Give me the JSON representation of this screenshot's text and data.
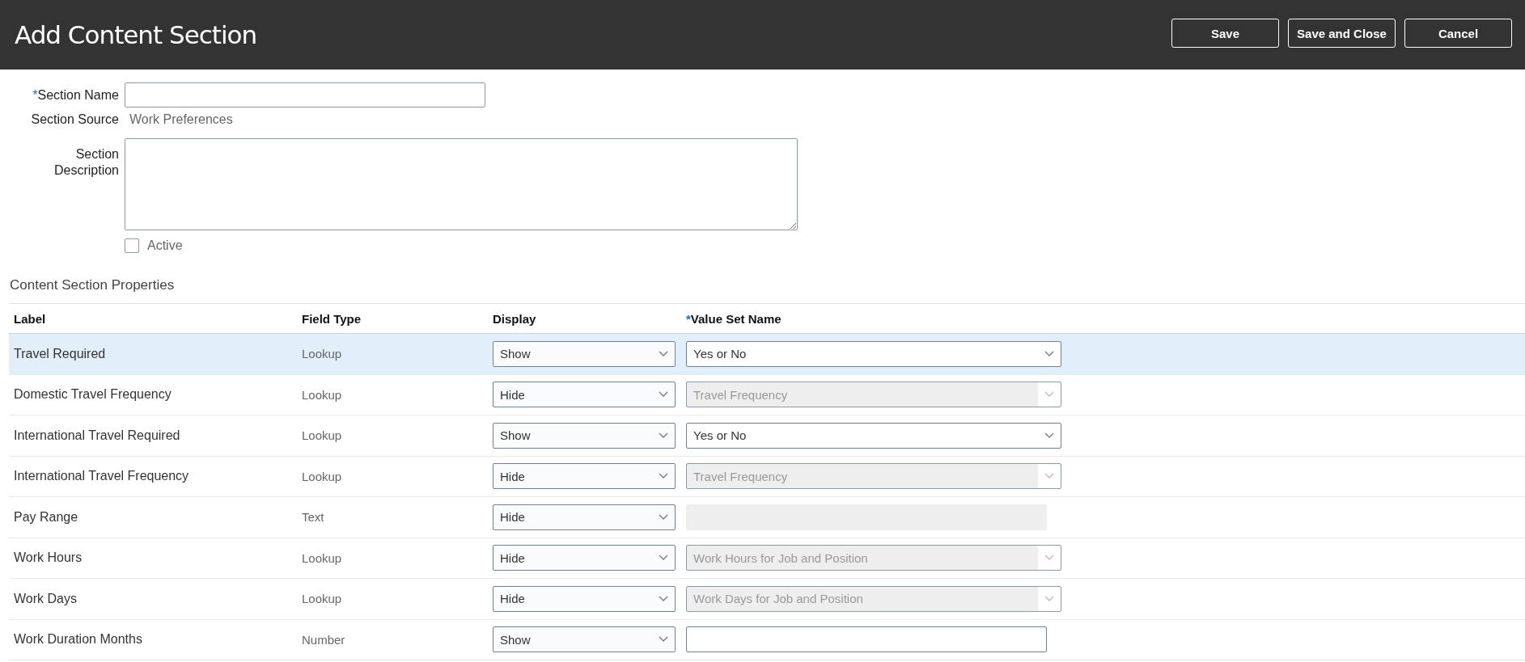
{
  "header": {
    "title": "Add Content Section",
    "buttons": [
      "Save",
      "Save and Close",
      "Cancel"
    ]
  },
  "form": {
    "section_name": {
      "label": "Section Name",
      "required_mark": "*"
    },
    "section_source": {
      "label": "Section Source",
      "value": "Work Preferences"
    },
    "section_description": {
      "label": "Section Description"
    },
    "active": {
      "label": "Active",
      "checked": false
    }
  },
  "properties": {
    "title": "Content Section Properties",
    "columns": [
      {
        "label": "Label"
      },
      {
        "label": "Field Type"
      },
      {
        "label": "Display"
      },
      {
        "label": "Value Set Name",
        "required_mark": "*"
      }
    ],
    "rows": [
      {
        "label": "Travel Required",
        "field_type": "Lookup",
        "display": "Show",
        "selected": true,
        "value_set": {
          "kind": "select",
          "value": "Yes or No",
          "disabled": false
        }
      },
      {
        "label": "Domestic Travel Frequency",
        "field_type": "Lookup",
        "display": "Hide",
        "selected": false,
        "value_set": {
          "kind": "select",
          "value": "Travel Frequency",
          "disabled": true
        }
      },
      {
        "label": "International Travel Required",
        "field_type": "Lookup",
        "display": "Show",
        "selected": false,
        "value_set": {
          "kind": "select",
          "value": "Yes or No",
          "disabled": false
        }
      },
      {
        "label": "International Travel Frequency",
        "field_type": "Lookup",
        "display": "Hide",
        "selected": false,
        "value_set": {
          "kind": "select",
          "value": "Travel Frequency",
          "disabled": true
        }
      },
      {
        "label": "Pay Range",
        "field_type": "Text",
        "display": "Hide",
        "selected": false,
        "value_set": {
          "kind": "text",
          "disabled": true
        }
      },
      {
        "label": "Work Hours",
        "field_type": "Lookup",
        "display": "Hide",
        "selected": false,
        "value_set": {
          "kind": "select",
          "value": "Work Hours for Job and Position",
          "disabled": true
        }
      },
      {
        "label": "Work Days",
        "field_type": "Lookup",
        "display": "Hide",
        "selected": false,
        "value_set": {
          "kind": "select",
          "value": "Work Days for Job and Position",
          "disabled": true
        }
      },
      {
        "label": "Work Duration Months",
        "field_type": "Number",
        "display": "Show",
        "selected": false,
        "value_set": {
          "kind": "text",
          "disabled": false
        }
      }
    ]
  }
}
